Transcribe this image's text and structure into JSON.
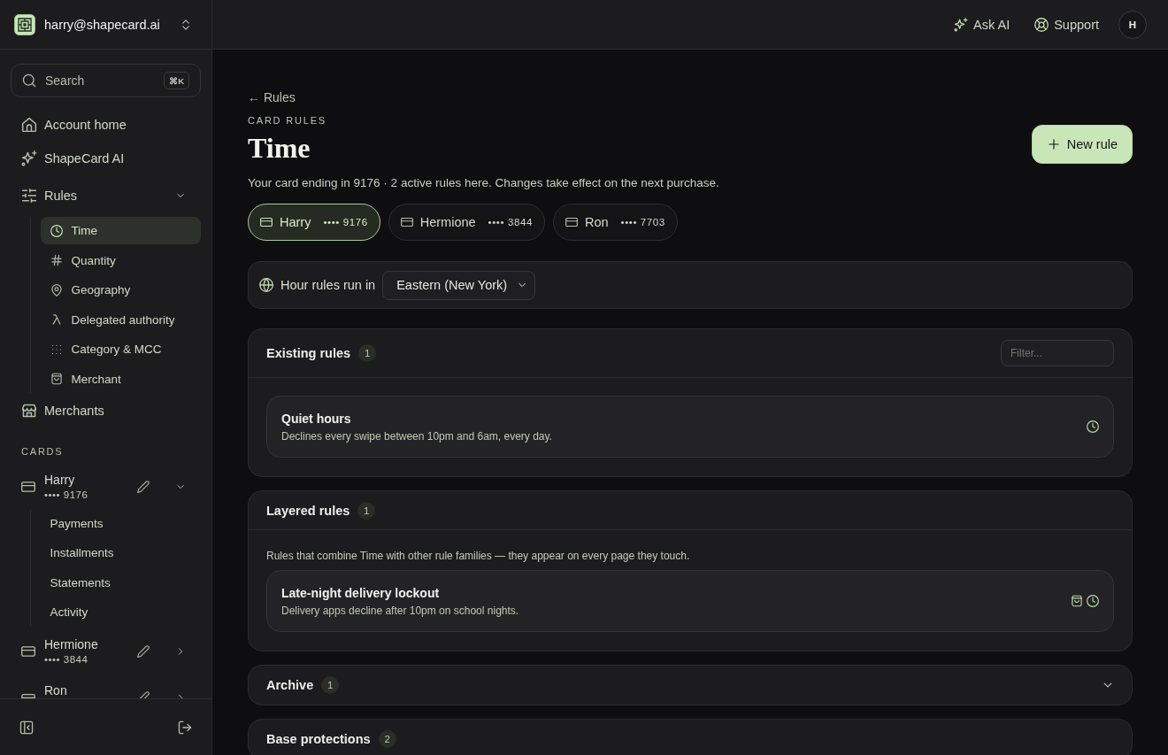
{
  "account": {
    "email": "harry@shapecard.ai"
  },
  "search": {
    "placeholder": "Search",
    "shortcut": "⌘K"
  },
  "sidebar": {
    "items": [
      {
        "label": "Account home",
        "selected": false
      },
      {
        "label": "ShapeCard AI",
        "selected": false
      },
      {
        "label": "Rules",
        "selected": false,
        "expanded": true,
        "children": [
          {
            "label": "Time",
            "selected": true
          },
          {
            "label": "Quantity",
            "selected": false
          },
          {
            "label": "Geography",
            "selected": false
          },
          {
            "label": "Delegated authority",
            "selected": false
          },
          {
            "label": "Category & MCC",
            "selected": false
          },
          {
            "label": "Merchant",
            "selected": false
          }
        ]
      },
      {
        "label": "Merchants",
        "selected": false
      }
    ],
    "cards_heading": "CARDS",
    "cards": [
      {
        "name": "Harry",
        "number": "•••• 9176",
        "expanded": true,
        "children": [
          {
            "label": "Payments",
            "selected": false
          },
          {
            "label": "Installments",
            "selected": false
          },
          {
            "label": "Statements",
            "selected": false
          },
          {
            "label": "Activity",
            "selected": false
          }
        ]
      },
      {
        "name": "Hermione",
        "number": "•••• 3844",
        "expanded": false
      },
      {
        "name": "Ron",
        "expanded": false
      }
    ]
  },
  "top_bar": {
    "actions": [
      {
        "label": "Ask AI"
      },
      {
        "label": "Support"
      }
    ],
    "avatar": "H"
  },
  "page": {
    "back_link": "← Rules",
    "eyebrow": "CARD RULES",
    "title": "Time",
    "new_rule_button": "New rule",
    "description": "Your card ending in 9176 · 2 active rules here. Changes take effect on the next purchase.",
    "cards": [
      {
        "name": "Harry",
        "number": "•••• 9176",
        "selected": true
      },
      {
        "name": "Hermione",
        "number": "•••• 3844",
        "selected": false
      },
      {
        "name": "Ron",
        "number": "•••• 7703",
        "selected": false
      }
    ],
    "timezone": {
      "label": "Hour rules run in",
      "value": "Eastern (New York)"
    },
    "sections": [
      {
        "title": "Existing rules",
        "count": "1",
        "expanded": true,
        "filter_placeholder": "Filter...",
        "rules": [
          {
            "title": "Quiet hours",
            "description": "Declines every swipe between 10pm and 6am, every day."
          }
        ]
      },
      {
        "title": "Layered rules",
        "count": "1",
        "expanded": true,
        "note": "Rules that combine Time with other rule families — they appear on every page they touch.",
        "rules": [
          {
            "title": "Late-night delivery lockout",
            "description": "Delivery apps decline after 10pm on school nights."
          }
        ]
      },
      {
        "title": "Archive",
        "count": "1",
        "expanded": false
      },
      {
        "title": "Base protections",
        "count": "2",
        "expanded": true
      }
    ]
  }
}
